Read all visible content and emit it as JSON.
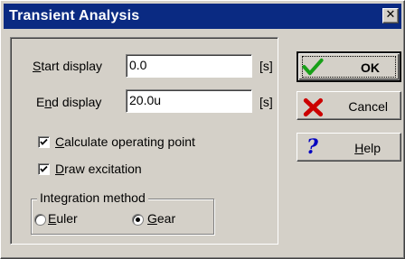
{
  "window": {
    "title": "Transient Analysis"
  },
  "fields": {
    "start_label_u": "S",
    "start_label_rest": "tart display",
    "start_value": "0.0",
    "start_unit": "[s]",
    "end_label_pre": "E",
    "end_label_u": "n",
    "end_label_rest": "d display",
    "end_value": "20.0u",
    "end_unit": "[s]"
  },
  "checks": {
    "calc_u": "C",
    "calc_rest": "alculate operating point",
    "calc_checked": true,
    "draw_u": "D",
    "draw_rest": "raw excitation",
    "draw_checked": true
  },
  "integration": {
    "legend": "Integration method",
    "euler_u": "E",
    "euler_rest": "uler",
    "gear_u": "G",
    "gear_rest": "ear",
    "selected": "Gear"
  },
  "buttons": {
    "ok": "OK",
    "cancel": "Cancel",
    "help_u": "H",
    "help_rest": "elp"
  },
  "icons": {
    "ok": "check-icon",
    "cancel": "x-icon",
    "help": "question-icon",
    "close": "close-icon"
  },
  "colors": {
    "titlebar": "#0a2a82",
    "check_green": "#18a018",
    "cancel_red": "#cc0000",
    "help_blue": "#0000c0"
  }
}
